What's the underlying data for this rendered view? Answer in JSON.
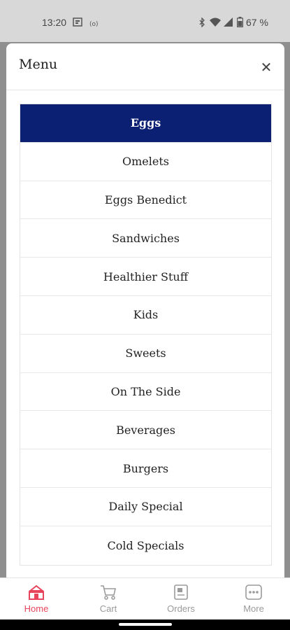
{
  "status_bar": {
    "time": "13:20",
    "battery": "67 %"
  },
  "sheet": {
    "title": "Menu",
    "close_icon": "close-icon"
  },
  "categories": [
    {
      "label": "Eggs",
      "active": true
    },
    {
      "label": "Omelets"
    },
    {
      "label": "Eggs Benedict"
    },
    {
      "label": "Sandwiches"
    },
    {
      "label": "Healthier Stuff"
    },
    {
      "label": "Kids"
    },
    {
      "label": "Sweets"
    },
    {
      "label": "On The Side"
    },
    {
      "label": "Beverages"
    },
    {
      "label": "Burgers"
    },
    {
      "label": "Daily Special"
    },
    {
      "label": "Cold Specials"
    }
  ],
  "bottom_nav": {
    "items": [
      {
        "label": "Home",
        "icon": "home-icon",
        "active": true
      },
      {
        "label": "Cart",
        "icon": "cart-icon"
      },
      {
        "label": "Orders",
        "icon": "orders-icon"
      },
      {
        "label": "More",
        "icon": "more-icon"
      }
    ]
  },
  "colors": {
    "active_category_bg": "#0b1f73",
    "nav_active": "#e8455c",
    "nav_inactive": "#9a9a9a"
  }
}
